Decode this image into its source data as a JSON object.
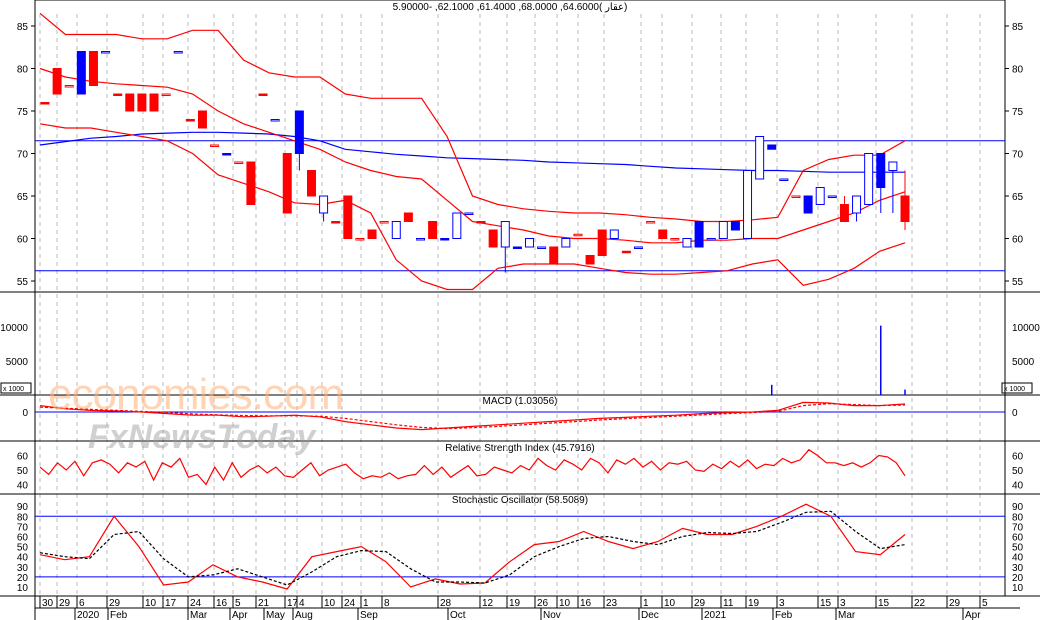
{
  "header": {
    "ohlc_text": "5.90000- ,62.1000 ,61.4000 ,68.0000 ,64.6000( عقار)"
  },
  "watermark": {
    "brand1": "economies.com",
    "brand2": "FxNewsToday"
  },
  "colors": {
    "up": "#0000ff",
    "down": "#ff0000",
    "bands": "#ff0000",
    "ma": "#0000ff",
    "grid": "#bbbbbb"
  },
  "chart_data": [
    {
      "type": "candlestick",
      "title": "5.90000- ,62.1000 ,61.4000 ,68.0000 ,64.6000( عقار)",
      "y_ticks": [
        "85",
        "80",
        "75",
        "70",
        "65",
        "60",
        "55"
      ],
      "ylim": [
        53,
        87
      ],
      "hlines": [
        71.5,
        56.2
      ],
      "candles_ohlc": [
        [
          76,
          76,
          76,
          76
        ],
        [
          80,
          80,
          77,
          77
        ],
        [
          78,
          78,
          78,
          78
        ],
        [
          77,
          82,
          77,
          82
        ],
        [
          82,
          82,
          78,
          78
        ],
        [
          82,
          82,
          82,
          82
        ],
        [
          77,
          77,
          77,
          77
        ],
        [
          77,
          77,
          75,
          75
        ],
        [
          77,
          77,
          75,
          75
        ],
        [
          77,
          77,
          75,
          75
        ],
        [
          77,
          77,
          77,
          77
        ],
        [
          82,
          82,
          82,
          82
        ],
        [
          74,
          74,
          74,
          74
        ],
        [
          75,
          75,
          73,
          73
        ],
        [
          71,
          71,
          71,
          71
        ],
        [
          70,
          70,
          70,
          70
        ],
        [
          69,
          69,
          69,
          69
        ],
        [
          69,
          69,
          64,
          64
        ],
        [
          77,
          77,
          77,
          77
        ],
        [
          74,
          74,
          74,
          74
        ],
        [
          70,
          70,
          63,
          63
        ],
        [
          70,
          75,
          68,
          75
        ],
        [
          68,
          68,
          65,
          65
        ],
        [
          63,
          65,
          62,
          65
        ],
        [
          62,
          62,
          62,
          62
        ],
        [
          65,
          65,
          60,
          60
        ],
        [
          60,
          60,
          60,
          60
        ],
        [
          61,
          61,
          60,
          60
        ],
        [
          62,
          62,
          62,
          62
        ],
        [
          60,
          62,
          60,
          62
        ],
        [
          63,
          63,
          62,
          62
        ],
        [
          60,
          60,
          60,
          60
        ],
        [
          62,
          62,
          60,
          60
        ],
        [
          60,
          60,
          60,
          60
        ],
        [
          60,
          63,
          60,
          63
        ],
        [
          63,
          63,
          63,
          63
        ],
        [
          62,
          62,
          62,
          62
        ],
        [
          61,
          61,
          59,
          59
        ],
        [
          59,
          62,
          56,
          62
        ],
        [
          59,
          59,
          59,
          59
        ],
        [
          59,
          60,
          59,
          60
        ],
        [
          59,
          59,
          59,
          59
        ],
        [
          59,
          59,
          57,
          57
        ],
        [
          59,
          60,
          59,
          60
        ],
        [
          60.5,
          60.5,
          60.5,
          60.5
        ],
        [
          58,
          58,
          57,
          57
        ],
        [
          61,
          61,
          58,
          58
        ],
        [
          60,
          61,
          60,
          61
        ],
        [
          58.5,
          58.5,
          58.5,
          58.5
        ],
        [
          59,
          59,
          59,
          59
        ],
        [
          62,
          62,
          62,
          62
        ],
        [
          61,
          61,
          60,
          60
        ],
        [
          60,
          60,
          60,
          60
        ],
        [
          59,
          60,
          59,
          60
        ],
        [
          59,
          62,
          59,
          62
        ],
        [
          60,
          60,
          60,
          60
        ],
        [
          60,
          62,
          60,
          62
        ],
        [
          61,
          62,
          61,
          62
        ],
        [
          60,
          68,
          60,
          68
        ],
        [
          67,
          72,
          67,
          72
        ],
        [
          70.5,
          71,
          70.5,
          71
        ],
        [
          67,
          67,
          67,
          67
        ],
        [
          65,
          65,
          65,
          65
        ],
        [
          63,
          65,
          63,
          65
        ],
        [
          64,
          66,
          64,
          66
        ],
        [
          65,
          65,
          65,
          65
        ],
        [
          64,
          65,
          62,
          62
        ],
        [
          63,
          65,
          62,
          65
        ],
        [
          64,
          70,
          64,
          70
        ],
        [
          66,
          70,
          63,
          70
        ],
        [
          68,
          69,
          63,
          69
        ],
        [
          65,
          68,
          61,
          62
        ]
      ],
      "bollinger_upper": [
        86.5,
        84,
        84,
        84,
        83.5,
        83.5,
        84.5,
        84.5,
        81,
        79.5,
        79,
        79,
        77,
        76.5,
        76.5,
        76.5,
        72,
        65,
        64,
        63.5,
        63.2,
        63,
        63,
        62.8,
        62.5,
        62.3,
        62,
        62,
        62.2,
        62.5,
        68,
        69.3,
        69.8,
        69.8,
        71.5
      ],
      "bollinger_lower": [
        73.5,
        73,
        73,
        72.5,
        72,
        71.5,
        70,
        67.5,
        66.5,
        65.5,
        64.2,
        64,
        64.5,
        63,
        57.5,
        55,
        54,
        54,
        56.5,
        57,
        57,
        57,
        56.5,
        56,
        55.8,
        55.8,
        56,
        56.2,
        57,
        57.5,
        54.5,
        55.2,
        56.5,
        58.5,
        59.5
      ],
      "bollinger_middle": [
        80,
        79,
        78.5,
        78.2,
        78,
        77.8,
        77,
        75,
        73.5,
        72.5,
        71.5,
        70.5,
        69,
        68,
        67.3,
        67,
        64.5,
        62,
        61.5,
        61,
        60.3,
        60,
        60,
        59.8,
        59.5,
        59.5,
        59.8,
        59.8,
        60,
        60,
        61,
        62,
        63,
        64.5,
        65.5
      ],
      "moving_average": [
        71,
        71.4,
        71.8,
        72,
        72.3,
        72.4,
        72.5,
        72.5,
        72.4,
        72.3,
        72,
        71.5,
        70.5,
        70.2,
        69.9,
        69.7,
        69.5,
        69.4,
        69.3,
        69.2,
        69,
        68.9,
        68.8,
        68.7,
        68.5,
        68.3,
        68.2,
        68.1,
        68,
        68,
        67.9,
        67.8,
        67.8,
        67.8,
        67.8
      ]
    },
    {
      "type": "bar",
      "title": "Volume",
      "y_ticks": [
        "10000",
        "5000"
      ],
      "unit_label": "x 1000",
      "ylim": [
        0,
        11000
      ],
      "spikes": [
        {
          "at_candle": 60,
          "value": 1500
        },
        {
          "at_candle": 69,
          "value": 10200
        },
        {
          "at_candle": 71,
          "value": 800
        }
      ]
    },
    {
      "type": "line",
      "title": "MACD (1.03056)",
      "y_ticks": [
        "0"
      ],
      "ylim": [
        -7,
        4
      ],
      "macd": [
        2,
        1,
        0.5,
        0.3,
        0,
        -0.5,
        -1,
        -1,
        -1.5,
        -1.3,
        -1,
        -1.5,
        -3,
        -4,
        -5,
        -5.5,
        -5,
        -4.5,
        -4,
        -3.5,
        -3,
        -2.5,
        -2,
        -1.7,
        -1.3,
        -1,
        -0.5,
        -0.2,
        0,
        0.5,
        3,
        2.8,
        2,
        2,
        2.5
      ],
      "signal": [
        1.5,
        1.2,
        0.8,
        0.5,
        0.2,
        -0.2,
        -0.6,
        -0.9,
        -1.1,
        -1.2,
        -1.2,
        -1.3,
        -2,
        -3,
        -4,
        -4.8,
        -5.2,
        -4.9,
        -4.5,
        -4,
        -3.5,
        -3,
        -2.5,
        -2.1,
        -1.7,
        -1.3,
        -0.9,
        -0.5,
        -0.2,
        0.2,
        2,
        2.6,
        2.3,
        2,
        2.2
      ]
    },
    {
      "type": "line",
      "title": "Relative Strength Index (45.7916)",
      "y_ticks": [
        "60",
        "50",
        "40"
      ],
      "ylim": [
        30,
        68
      ],
      "rsi": [
        52,
        47,
        55,
        50,
        56,
        46,
        55,
        57,
        54,
        48,
        55,
        52,
        56,
        43,
        55,
        52,
        58,
        45,
        47,
        40,
        52,
        43,
        55,
        45,
        50,
        53,
        48,
        52,
        46,
        45,
        50,
        55,
        46,
        50,
        52,
        54,
        48,
        44,
        46,
        45,
        48,
        44,
        46,
        47,
        53,
        47,
        52,
        45,
        49,
        53,
        46,
        47,
        52,
        50,
        48,
        53,
        50,
        58,
        53,
        50,
        57,
        54,
        50,
        58,
        55,
        48,
        57,
        54,
        58,
        52,
        56,
        50,
        55,
        54,
        56,
        50,
        49,
        54,
        51,
        56,
        52,
        57,
        51,
        54,
        53,
        58,
        55,
        57,
        64,
        60,
        55,
        55,
        53,
        55,
        52,
        55,
        60,
        59,
        55,
        46
      ]
    },
    {
      "type": "line",
      "title": "Stochastic Oscillator (58.5089)",
      "y_ticks": [
        "90",
        "80",
        "70",
        "60",
        "50",
        "40",
        "30",
        "20",
        "10"
      ],
      "ylim": [
        0,
        100
      ],
      "hlines": [
        80,
        20
      ],
      "k": [
        42,
        37,
        40,
        80,
        50,
        12,
        15,
        32,
        20,
        15,
        8,
        40,
        45,
        50,
        35,
        10,
        18,
        13,
        14,
        35,
        52,
        55,
        65,
        55,
        48,
        55,
        68,
        62,
        62,
        70,
        80,
        92,
        80,
        45,
        42,
        62
      ],
      "d": [
        44,
        40,
        38,
        62,
        65,
        38,
        20,
        22,
        28,
        20,
        12,
        25,
        40,
        46,
        45,
        28,
        15,
        15,
        14,
        22,
        40,
        50,
        58,
        60,
        55,
        52,
        60,
        64,
        63,
        65,
        74,
        84,
        85,
        65,
        48,
        52
      ]
    }
  ],
  "x_axis": {
    "day_ticks": [
      "30",
      "29",
      "6",
      "29",
      "10",
      "17",
      "24",
      "16",
      "5",
      "21",
      "17",
      "4",
      "10",
      "24",
      "1",
      "8",
      "28",
      "12",
      "19",
      "26",
      "10",
      "16",
      "23",
      "1",
      "10",
      "29",
      "11",
      "19",
      "3",
      "15",
      "3",
      "15",
      "22",
      "29",
      "5"
    ],
    "month_labels": [
      "2020",
      "Feb",
      "Mar",
      "Apr",
      "May",
      "Aug",
      "Sep",
      "Oct",
      "Nov",
      "Dec",
      "2021",
      "Feb",
      "Mar",
      "Apr"
    ]
  }
}
